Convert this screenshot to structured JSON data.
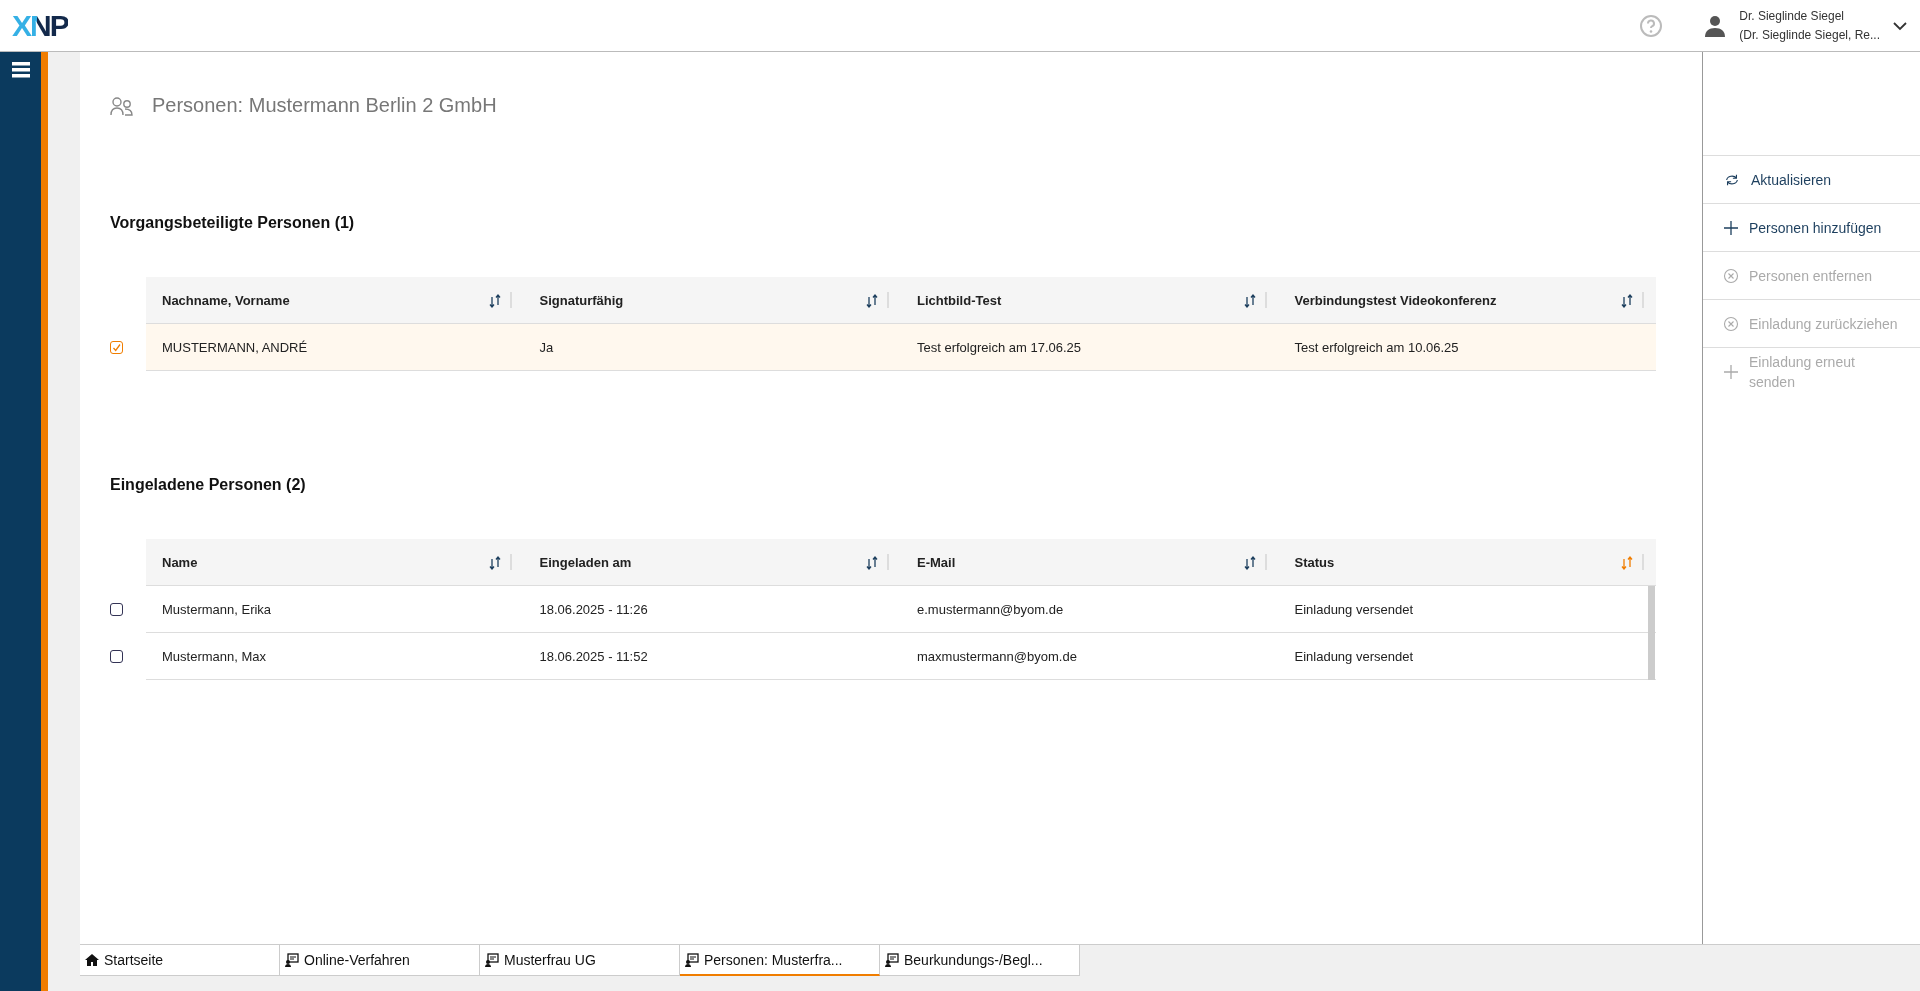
{
  "header": {
    "logo": "XNP",
    "user": {
      "name": "Dr. Sieglinde Siegel",
      "role": "(Dr. Sieglinde Siegel, Re..."
    }
  },
  "page_title": "Personen: Mustermann Berlin 2 GmbH",
  "sections": [
    {
      "heading": "Vorgangsbeteiligte Personen (1)",
      "scrollbar": false,
      "columns": [
        {
          "label": "Nachname, Vorname",
          "sort_active": false
        },
        {
          "label": "Signaturfähig",
          "sort_active": false
        },
        {
          "label": "Lichtbild-Test",
          "sort_active": false
        },
        {
          "label": "Verbindungstest Videokonferenz",
          "sort_active": false
        }
      ],
      "rows": [
        {
          "checked": true,
          "cells": [
            "MUSTERMANN, ANDRÉ",
            "Ja",
            "Test erfolgreich am 17.06.25",
            "Test erfolgreich am 10.06.25"
          ]
        }
      ]
    },
    {
      "heading": "Eingeladene Personen (2)",
      "scrollbar": true,
      "columns": [
        {
          "label": "Name",
          "sort_active": false
        },
        {
          "label": "Eingeladen am",
          "sort_active": false
        },
        {
          "label": "E-Mail",
          "sort_active": false
        },
        {
          "label": "Status",
          "sort_active": true
        }
      ],
      "rows": [
        {
          "checked": false,
          "cells": [
            "Mustermann, Erika",
            "18.06.2025 - 11:26",
            "e.mustermann@byom.de",
            "Einladung versendet"
          ]
        },
        {
          "checked": false,
          "cells": [
            "Mustermann, Max",
            "18.06.2025 - 11:52",
            "maxmustermann@byom.de",
            "Einladung versendet"
          ]
        }
      ]
    }
  ],
  "actions": [
    {
      "label": "Aktualisieren",
      "kind": "refresh",
      "disabled": false
    },
    {
      "label": "Personen hinzufügen",
      "kind": "add",
      "disabled": false
    },
    {
      "label": "Personen entfernen",
      "kind": "remove",
      "disabled": true
    },
    {
      "label": "Einladung zurückziehen",
      "kind": "remove",
      "disabled": true
    },
    {
      "label": "Einladung erneut senden",
      "kind": "add",
      "disabled": true
    }
  ],
  "tabs": [
    {
      "label": "Startseite",
      "kind": "home",
      "selected": false
    },
    {
      "label": "Online-Verfahren",
      "kind": "case",
      "selected": false
    },
    {
      "label": "Musterfrau UG",
      "kind": "case",
      "selected": false
    },
    {
      "label": "Personen: Musterfra...",
      "kind": "case",
      "selected": true
    },
    {
      "label": "Beurkundungs-/Begl...",
      "kind": "case",
      "selected": false
    }
  ]
}
